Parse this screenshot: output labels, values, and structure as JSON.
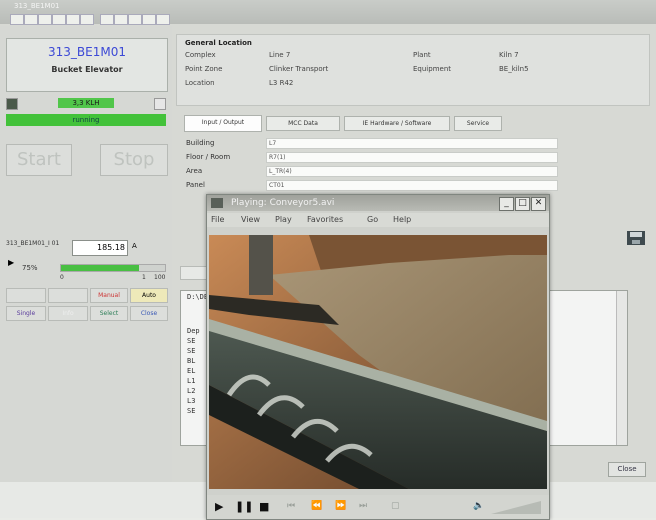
{
  "window": {
    "title": "313_BE1M01"
  },
  "equipment": {
    "code": "313_BE1M01",
    "name": "Bucket Elevator",
    "hours": "3,3 KLH",
    "state": "running",
    "start_label": "Start",
    "stop_label": "Stop",
    "reading_label": "313_BE1M01_I 01",
    "reading_value": "185.18",
    "reading_unit": "A",
    "percent_label": "75%",
    "percent_value": 75,
    "scale_min": "0",
    "scale_max": "1",
    "scale_end": "100",
    "mode_buttons": [
      "",
      "",
      "Manual",
      "Auto"
    ],
    "action_buttons": [
      "Single",
      "Info",
      "Select",
      "Close"
    ],
    "accent_running": "#43c23a",
    "accent_code": "#3c49d6"
  },
  "general": {
    "header": "General Location",
    "rows": [
      {
        "k1": "Complex",
        "v1": "Line 7",
        "k2": "Plant",
        "v2": "Kiln 7"
      },
      {
        "k1": "Point Zone",
        "v1": "Clinker Transport",
        "k2": "Equipment",
        "v2": "BE_kiln5"
      },
      {
        "k1": "Location",
        "v1": "L3 R42",
        "k2": "",
        "v2": ""
      }
    ]
  },
  "tabs": [
    "Input / Output",
    "MCC Data",
    "IE Hardware / Software",
    "Service"
  ],
  "io_fields": [
    {
      "label": "Building",
      "value": "L7"
    },
    {
      "label": "Floor / Room",
      "value": "R7(1)"
    },
    {
      "label": "Area",
      "value": "L_TR(4)"
    },
    {
      "label": "Panel",
      "value": "CT01"
    }
  ],
  "text_area": {
    "header": "D:\\DE",
    "lines": [
      "Dep",
      "SE",
      "SE",
      "BL",
      "EL",
      "L1",
      "L2",
      "L3",
      "SE"
    ]
  },
  "close_label": "Close",
  "player": {
    "title": "Playing: Conveyor5.avi",
    "menu": [
      "File",
      "View",
      "Play",
      "Favorites",
      "Go",
      "Help"
    ],
    "min_label": "_",
    "max_label": "□",
    "close_label": "✕"
  }
}
